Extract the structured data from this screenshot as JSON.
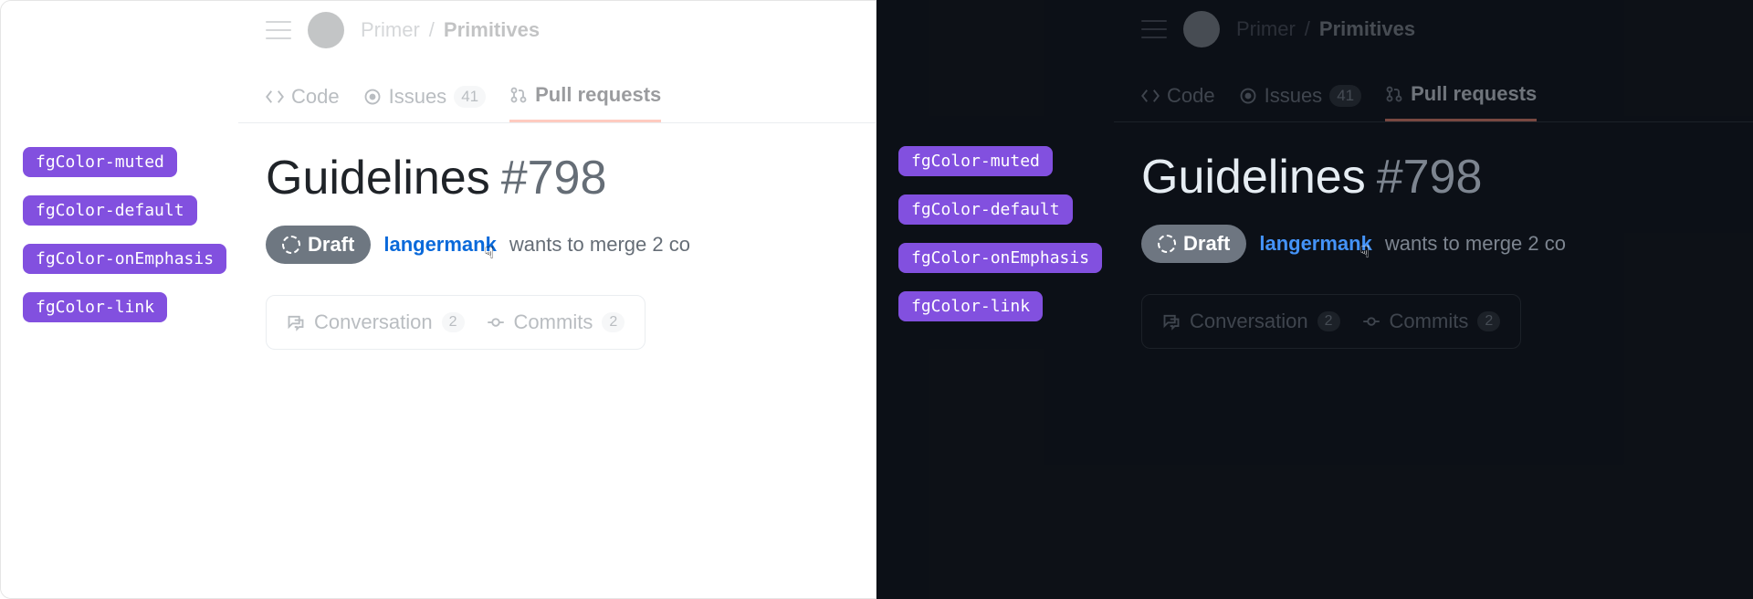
{
  "annotations": {
    "muted": "fgColor-muted",
    "default": "fgColor-default",
    "onEmphasis": "fgColor-onEmphasis",
    "link": "fgColor-link"
  },
  "breadcrumb": {
    "parent": "Primer",
    "separator": "/",
    "current": "Primitives"
  },
  "tabs": {
    "code": "Code",
    "issues": "Issues",
    "issues_count": "41",
    "pulls": "Pull requests"
  },
  "title": {
    "name": "Guidelines",
    "number": "#798"
  },
  "meta": {
    "draft": "Draft",
    "username": "langermank",
    "text": "wants to merge 2 co"
  },
  "subtabs": {
    "conversation": "Conversation",
    "conversation_count": "2",
    "commits": "Commits",
    "commits_count": "2"
  }
}
